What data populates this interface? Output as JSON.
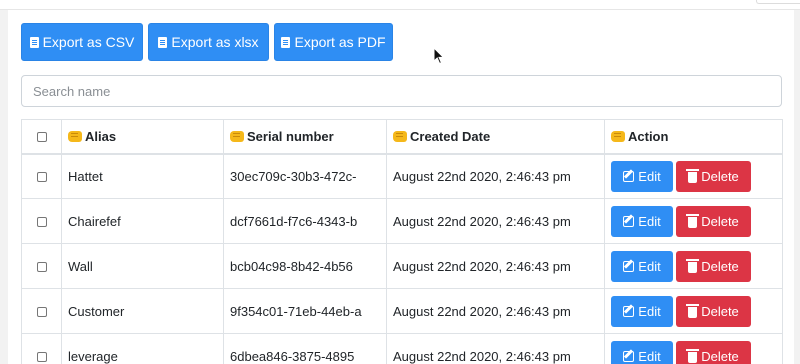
{
  "toolbar": {
    "export_csv": "Export as CSV",
    "export_xlsx": "Export as xlsx",
    "export_pdf": "Export as PDF"
  },
  "search": {
    "placeholder": "Search name",
    "value": ""
  },
  "table": {
    "headers": {
      "alias": "Alias",
      "serial": "Serial number",
      "created": "Created Date",
      "action": "Action"
    },
    "rows": [
      {
        "alias": "Hattet",
        "serial": "30ec709c-30b3-472c-",
        "created": "August 22nd 2020, 2:46:43 pm"
      },
      {
        "alias": "Chairefef",
        "serial": "dcf7661d-f7c6-4343-b",
        "created": "August 22nd 2020, 2:46:43 pm"
      },
      {
        "alias": "Wall",
        "serial": "bcb04c98-8b42-4b56",
        "created": "August 22nd 2020, 2:46:43 pm"
      },
      {
        "alias": "Customer",
        "serial": "9f354c01-71eb-44eb-a",
        "created": "August 22nd 2020, 2:46:43 pm"
      },
      {
        "alias": "leverage",
        "serial": "6dbea846-3875-4895",
        "created": "August 22nd 2020, 2:46:43 pm"
      }
    ],
    "edit_label": "Edit",
    "delete_label": "Delete"
  },
  "colors": {
    "primary": "#2f8ef4",
    "danger": "#dc3545",
    "border": "#dee2e6",
    "header_icon": "#f5b81a"
  },
  "icons": {
    "export_file": "file-icon",
    "header_marker": "fist-icon",
    "edit": "edit-icon",
    "delete": "trash-icon"
  }
}
